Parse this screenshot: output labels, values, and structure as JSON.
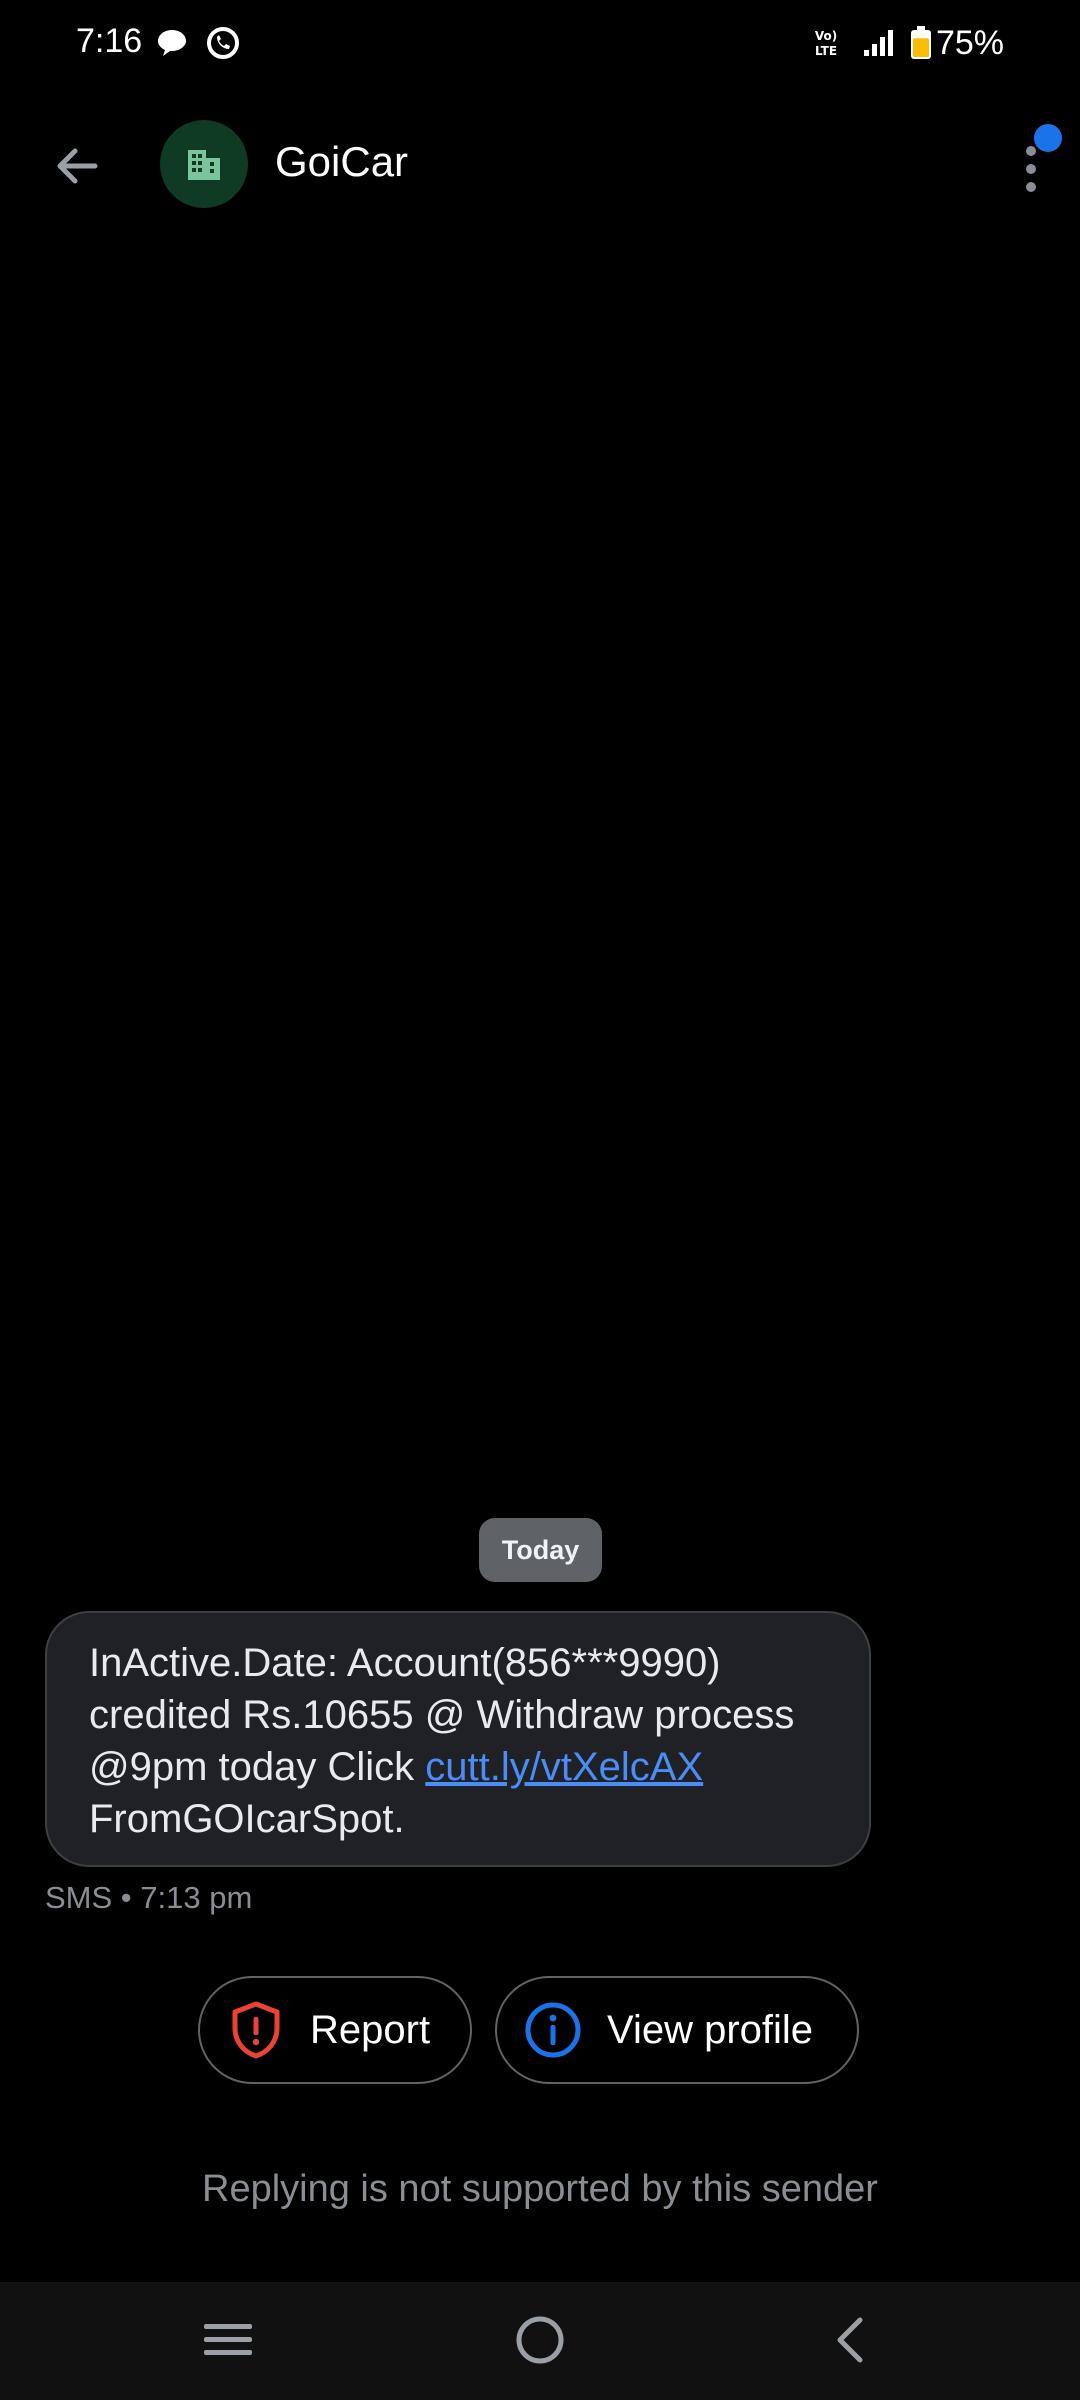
{
  "status_bar": {
    "time": "7:16",
    "battery_percent": "75%",
    "battery_level": 0.75,
    "icons": [
      "chat-bubble-icon",
      "whatsapp-icon",
      "volte-icon",
      "signal-icon",
      "battery-icon"
    ]
  },
  "header": {
    "title": "GoiCar",
    "avatar_icon": "building-icon",
    "back_icon": "arrow-left-icon",
    "menu_icon": "more-vert-icon"
  },
  "conversation": {
    "date_chip": "Today",
    "message": {
      "text_before_link": "InActive.Date: Account(856***9990) credited Rs.10655 @ Withdraw process @9pm today Click ",
      "link_text": "cutt.ly/vtXelcAX",
      "text_after_link": " FromGOIcarSpot.",
      "meta": "SMS • 7:13 pm"
    }
  },
  "actions": {
    "report_label": "Report",
    "report_icon": "shield-alert-icon",
    "view_profile_label": "View profile",
    "view_profile_icon": "info-icon"
  },
  "reply_note": "Replying is not supported by this sender",
  "nav_bar": {
    "icons": [
      "menu-icon",
      "home-icon",
      "back-icon"
    ]
  },
  "colors": {
    "background": "#000000",
    "bubble": "#202124",
    "link": "#4b8df8",
    "report_red": "#ea4335",
    "info_blue": "#1a73e8",
    "avatar_bg": "#0f3b24",
    "battery_yellow": "#fbbc04"
  }
}
